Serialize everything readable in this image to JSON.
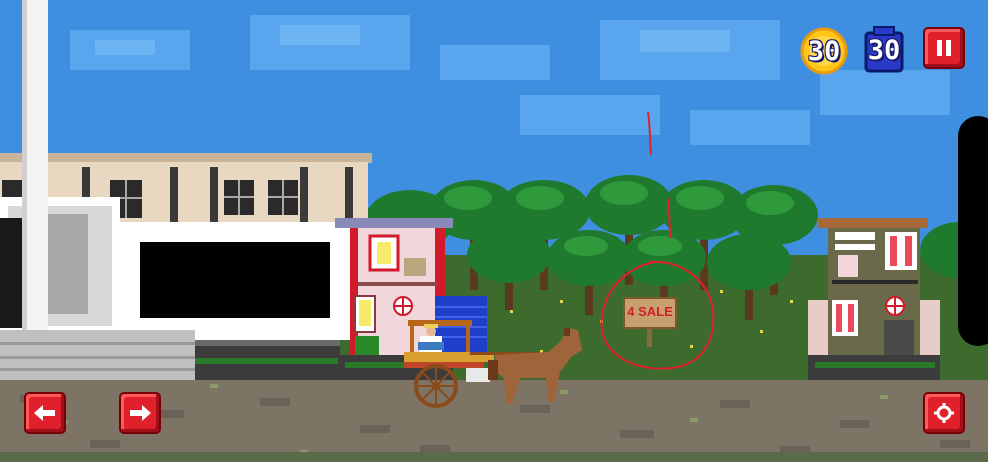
{
  "hud": {
    "coin_count": "30",
    "bag_count": "30"
  },
  "sign": {
    "text": "4 SALE"
  },
  "controls": {
    "left": "left-arrow-icon",
    "right": "right-arrow-icon",
    "pause": "pause-icon",
    "settings": "gear-icon"
  },
  "colors": {
    "sky": "#3f8fe0",
    "grass": "#3d6b2d",
    "road": "#7d7466",
    "button_red": "#e0202a",
    "coin_gold": "#ffc61a"
  }
}
